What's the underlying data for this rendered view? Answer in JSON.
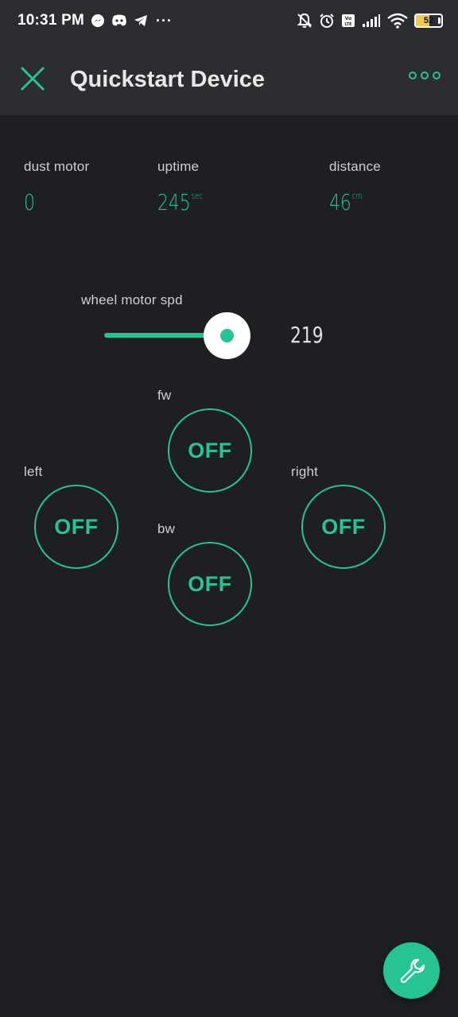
{
  "status_bar": {
    "time": "10:31 PM",
    "dots": "···",
    "battery_level": 52,
    "battery_text": "52",
    "left_icons": [
      "messenger-icon",
      "discord-icon",
      "telegram-icon"
    ],
    "right_icons": [
      "notifications-off-icon",
      "alarm-icon",
      "volte-icon",
      "signal-icon",
      "wifi-icon",
      "battery-icon"
    ]
  },
  "app_bar": {
    "title": "Quickstart Device",
    "close_icon": "close-icon",
    "more_icon": "more-options-icon"
  },
  "widgets": {
    "dust_motor": {
      "label": "dust motor",
      "value": "0",
      "unit": ""
    },
    "uptime": {
      "label": "uptime",
      "value": "245",
      "unit": "sec"
    },
    "distance": {
      "label": "distance",
      "value": "46",
      "unit": "cm"
    }
  },
  "slider": {
    "label": "wheel motor spd",
    "value": "219"
  },
  "buttons": {
    "fw": {
      "label": "fw",
      "state": "OFF"
    },
    "left": {
      "label": "left",
      "state": "OFF"
    },
    "right": {
      "label": "right",
      "state": "OFF"
    },
    "bw": {
      "label": "bw",
      "state": "OFF"
    }
  },
  "fab": {
    "icon": "wrench-icon"
  },
  "colors": {
    "accent": "#26c495",
    "background": "#1e1f22",
    "bar": "#2c2d31"
  }
}
